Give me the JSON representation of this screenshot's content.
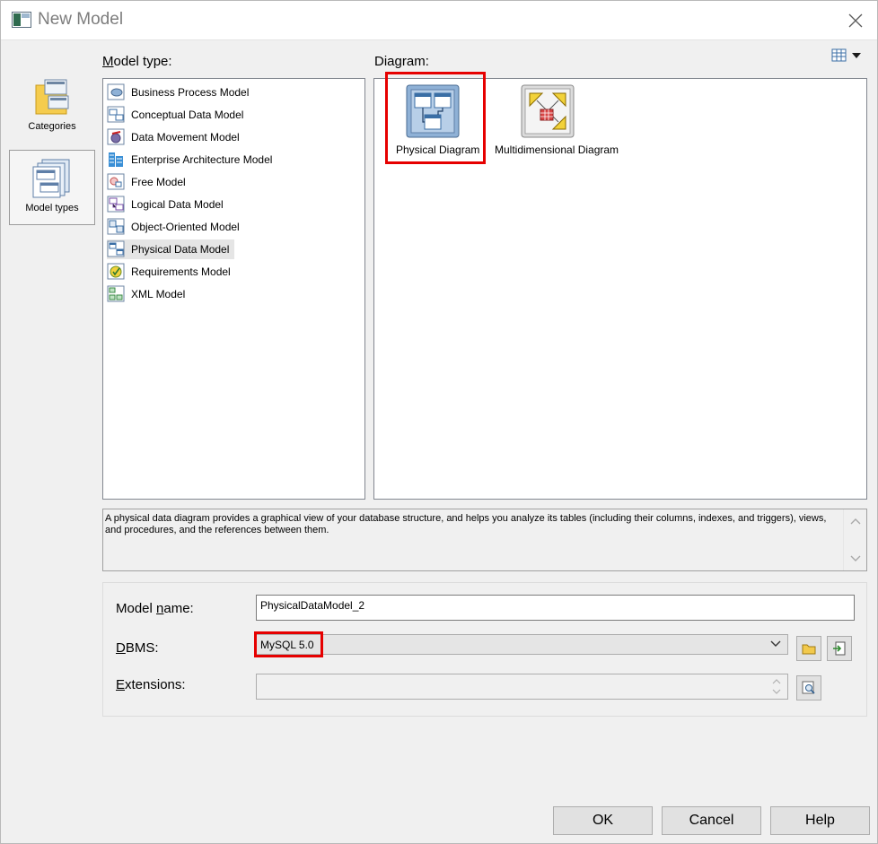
{
  "window": {
    "title": "New Model"
  },
  "categories": [
    {
      "label": "Categories",
      "icon": "folder-icon",
      "selected": false
    },
    {
      "label": "Model types",
      "icon": "model-types-icon",
      "selected": true
    }
  ],
  "model_type": {
    "label_prefix": "",
    "label_underlined": "M",
    "label_rest": "odel type:",
    "items": [
      {
        "label": "Business Process Model",
        "icon": "business-process-icon",
        "selected": false
      },
      {
        "label": "Conceptual Data Model",
        "icon": "conceptual-data-icon",
        "selected": false
      },
      {
        "label": "Data Movement Model",
        "icon": "data-movement-icon",
        "selected": false
      },
      {
        "label": "Enterprise Architecture Model",
        "icon": "enterprise-architecture-icon",
        "selected": false
      },
      {
        "label": "Free Model",
        "icon": "free-model-icon",
        "selected": false
      },
      {
        "label": "Logical Data Model",
        "icon": "logical-data-icon",
        "selected": false
      },
      {
        "label": "Object-Oriented Model",
        "icon": "object-oriented-icon",
        "selected": false
      },
      {
        "label": "Physical Data Model",
        "icon": "physical-data-icon",
        "selected": true
      },
      {
        "label": "Requirements Model",
        "icon": "requirements-icon",
        "selected": false
      },
      {
        "label": "XML Model",
        "icon": "xml-model-icon",
        "selected": false
      }
    ]
  },
  "diagram": {
    "label_prefix": "Dia",
    "label_underlined": "g",
    "label_rest": "ram:",
    "items": [
      {
        "label": "Physical Diagram",
        "icon": "physical-diagram-icon",
        "selected": true
      },
      {
        "label": "Multidimensional Diagram",
        "icon": "multidimensional-diagram-icon",
        "selected": false
      }
    ]
  },
  "description": "A physical data diagram provides a graphical view of your database structure, and helps you analyze its tables (including their columns, indexes, and triggers), views, and procedures, and the references between them.",
  "form": {
    "model_name_prefix": "Model ",
    "model_name_underlined": "n",
    "model_name_rest": "ame:",
    "model_name_value": "PhysicalDataModel_2",
    "dbms_prefix": "",
    "dbms_underlined": "D",
    "dbms_rest": "BMS:",
    "dbms_value": "MySQL 5.0",
    "extensions_prefix": "",
    "extensions_underlined": "E",
    "extensions_rest": "xtensions:",
    "extensions_value": ""
  },
  "buttons": {
    "ok": "OK",
    "cancel": "Cancel",
    "help": "Help"
  },
  "colors": {
    "highlight_red": "#e60000",
    "selection_gray": "#e5e5e5",
    "button_face": "#e1e1e1"
  }
}
